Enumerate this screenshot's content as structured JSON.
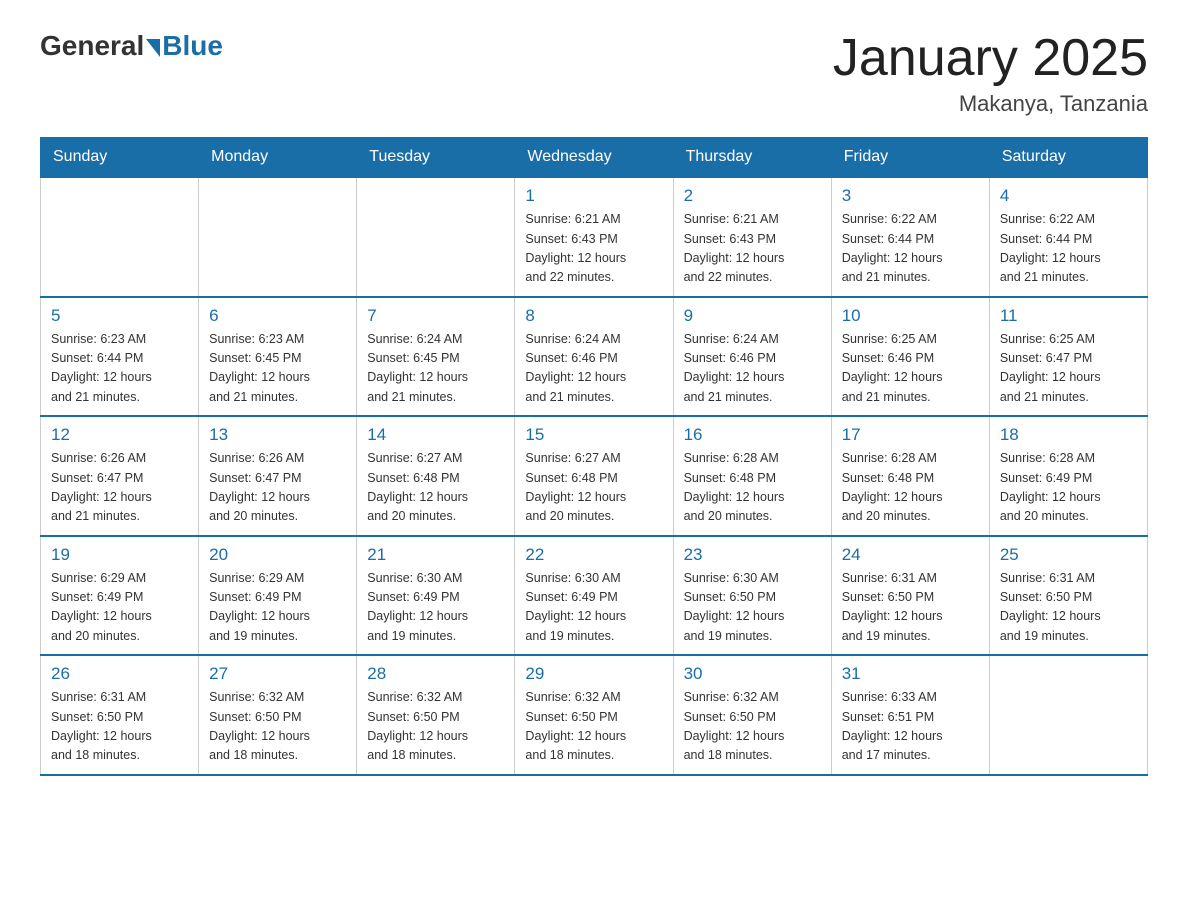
{
  "logo": {
    "general": "General",
    "blue": "Blue"
  },
  "title": "January 2025",
  "location": "Makanya, Tanzania",
  "days_of_week": [
    "Sunday",
    "Monday",
    "Tuesday",
    "Wednesday",
    "Thursday",
    "Friday",
    "Saturday"
  ],
  "weeks": [
    [
      {
        "day": "",
        "info": ""
      },
      {
        "day": "",
        "info": ""
      },
      {
        "day": "",
        "info": ""
      },
      {
        "day": "1",
        "info": "Sunrise: 6:21 AM\nSunset: 6:43 PM\nDaylight: 12 hours\nand 22 minutes."
      },
      {
        "day": "2",
        "info": "Sunrise: 6:21 AM\nSunset: 6:43 PM\nDaylight: 12 hours\nand 22 minutes."
      },
      {
        "day": "3",
        "info": "Sunrise: 6:22 AM\nSunset: 6:44 PM\nDaylight: 12 hours\nand 21 minutes."
      },
      {
        "day": "4",
        "info": "Sunrise: 6:22 AM\nSunset: 6:44 PM\nDaylight: 12 hours\nand 21 minutes."
      }
    ],
    [
      {
        "day": "5",
        "info": "Sunrise: 6:23 AM\nSunset: 6:44 PM\nDaylight: 12 hours\nand 21 minutes."
      },
      {
        "day": "6",
        "info": "Sunrise: 6:23 AM\nSunset: 6:45 PM\nDaylight: 12 hours\nand 21 minutes."
      },
      {
        "day": "7",
        "info": "Sunrise: 6:24 AM\nSunset: 6:45 PM\nDaylight: 12 hours\nand 21 minutes."
      },
      {
        "day": "8",
        "info": "Sunrise: 6:24 AM\nSunset: 6:46 PM\nDaylight: 12 hours\nand 21 minutes."
      },
      {
        "day": "9",
        "info": "Sunrise: 6:24 AM\nSunset: 6:46 PM\nDaylight: 12 hours\nand 21 minutes."
      },
      {
        "day": "10",
        "info": "Sunrise: 6:25 AM\nSunset: 6:46 PM\nDaylight: 12 hours\nand 21 minutes."
      },
      {
        "day": "11",
        "info": "Sunrise: 6:25 AM\nSunset: 6:47 PM\nDaylight: 12 hours\nand 21 minutes."
      }
    ],
    [
      {
        "day": "12",
        "info": "Sunrise: 6:26 AM\nSunset: 6:47 PM\nDaylight: 12 hours\nand 21 minutes."
      },
      {
        "day": "13",
        "info": "Sunrise: 6:26 AM\nSunset: 6:47 PM\nDaylight: 12 hours\nand 20 minutes."
      },
      {
        "day": "14",
        "info": "Sunrise: 6:27 AM\nSunset: 6:48 PM\nDaylight: 12 hours\nand 20 minutes."
      },
      {
        "day": "15",
        "info": "Sunrise: 6:27 AM\nSunset: 6:48 PM\nDaylight: 12 hours\nand 20 minutes."
      },
      {
        "day": "16",
        "info": "Sunrise: 6:28 AM\nSunset: 6:48 PM\nDaylight: 12 hours\nand 20 minutes."
      },
      {
        "day": "17",
        "info": "Sunrise: 6:28 AM\nSunset: 6:48 PM\nDaylight: 12 hours\nand 20 minutes."
      },
      {
        "day": "18",
        "info": "Sunrise: 6:28 AM\nSunset: 6:49 PM\nDaylight: 12 hours\nand 20 minutes."
      }
    ],
    [
      {
        "day": "19",
        "info": "Sunrise: 6:29 AM\nSunset: 6:49 PM\nDaylight: 12 hours\nand 20 minutes."
      },
      {
        "day": "20",
        "info": "Sunrise: 6:29 AM\nSunset: 6:49 PM\nDaylight: 12 hours\nand 19 minutes."
      },
      {
        "day": "21",
        "info": "Sunrise: 6:30 AM\nSunset: 6:49 PM\nDaylight: 12 hours\nand 19 minutes."
      },
      {
        "day": "22",
        "info": "Sunrise: 6:30 AM\nSunset: 6:49 PM\nDaylight: 12 hours\nand 19 minutes."
      },
      {
        "day": "23",
        "info": "Sunrise: 6:30 AM\nSunset: 6:50 PM\nDaylight: 12 hours\nand 19 minutes."
      },
      {
        "day": "24",
        "info": "Sunrise: 6:31 AM\nSunset: 6:50 PM\nDaylight: 12 hours\nand 19 minutes."
      },
      {
        "day": "25",
        "info": "Sunrise: 6:31 AM\nSunset: 6:50 PM\nDaylight: 12 hours\nand 19 minutes."
      }
    ],
    [
      {
        "day": "26",
        "info": "Sunrise: 6:31 AM\nSunset: 6:50 PM\nDaylight: 12 hours\nand 18 minutes."
      },
      {
        "day": "27",
        "info": "Sunrise: 6:32 AM\nSunset: 6:50 PM\nDaylight: 12 hours\nand 18 minutes."
      },
      {
        "day": "28",
        "info": "Sunrise: 6:32 AM\nSunset: 6:50 PM\nDaylight: 12 hours\nand 18 minutes."
      },
      {
        "day": "29",
        "info": "Sunrise: 6:32 AM\nSunset: 6:50 PM\nDaylight: 12 hours\nand 18 minutes."
      },
      {
        "day": "30",
        "info": "Sunrise: 6:32 AM\nSunset: 6:50 PM\nDaylight: 12 hours\nand 18 minutes."
      },
      {
        "day": "31",
        "info": "Sunrise: 6:33 AM\nSunset: 6:51 PM\nDaylight: 12 hours\nand 17 minutes."
      },
      {
        "day": "",
        "info": ""
      }
    ]
  ]
}
